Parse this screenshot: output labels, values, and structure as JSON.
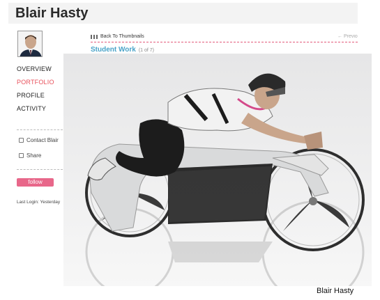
{
  "profile": {
    "name": "Blair Hasty"
  },
  "nav": {
    "items": [
      {
        "label": "OVERVIEW",
        "active": false
      },
      {
        "label": "PORTFOLIO",
        "active": true
      },
      {
        "label": "PROFILE",
        "active": false
      },
      {
        "label": "ACTIVITY",
        "active": false
      }
    ]
  },
  "actions": {
    "contact_label": "Contact Blair",
    "share_label": "Share",
    "follow_label": "follow",
    "last_login": "Last Login: Yesterday"
  },
  "gallery": {
    "back_label": "Back To Thumbnails",
    "prev_label": "← Previous",
    "section_title": "Student Work",
    "count": "(1 of 7)"
  },
  "caption": "Blair Hasty",
  "colors": {
    "accent": "#e8505b",
    "follow": "#e8678a",
    "title_blue": "#4aa3c8"
  },
  "icons": [
    "user-avatar",
    "grid-icon",
    "mail-icon",
    "share-icon"
  ]
}
